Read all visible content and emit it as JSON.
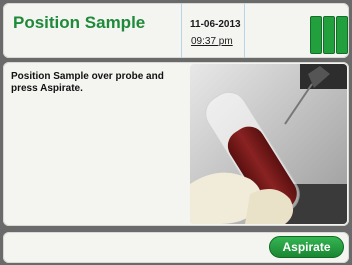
{
  "header": {
    "title": "Position Sample",
    "date": "11-06-2013",
    "time": "09:37 pm"
  },
  "main": {
    "instruction": "Position Sample over probe and press Aspirate."
  },
  "footer": {
    "aspirate_label": "Aspirate"
  },
  "colors": {
    "accent_green": "#1f8a3a",
    "status_bar_green": "#22a03e",
    "sample_red": "#7a1d1d"
  },
  "status_bars": {
    "count": 3,
    "level": 1.0
  }
}
